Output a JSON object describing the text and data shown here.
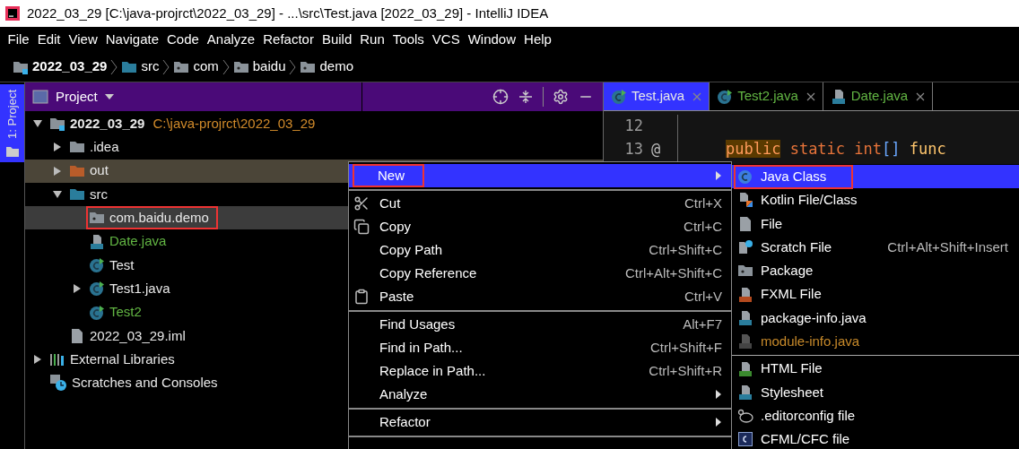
{
  "window": {
    "title": "2022_03_29 [C:\\java-projrct\\2022_03_29] - ...\\src\\Test.java [2022_03_29] - IntelliJ IDEA"
  },
  "menu_bar": [
    "File",
    "Edit",
    "View",
    "Navigate",
    "Code",
    "Analyze",
    "Refactor",
    "Build",
    "Run",
    "Tools",
    "VCS",
    "Window",
    "Help"
  ],
  "breadcrumb": [
    {
      "label": "2022_03_29",
      "kind": "project"
    },
    {
      "label": "src",
      "kind": "source"
    },
    {
      "label": "com",
      "kind": "package"
    },
    {
      "label": "baidu",
      "kind": "package"
    },
    {
      "label": "demo",
      "kind": "package"
    }
  ],
  "tool_stripe": {
    "label": "1: Project",
    "selected": true
  },
  "project_panel": {
    "title": "Project",
    "tree": [
      {
        "label": "2022_03_29",
        "kind": "project",
        "path": "C:\\java-projrct\\2022_03_29",
        "expanded": true,
        "selected": false,
        "hovered": false,
        "outlined": false,
        "added": false,
        "children": [
          {
            "label": ".idea",
            "kind": "folder",
            "expanded": false,
            "selected": false,
            "hovered": false,
            "outlined": false,
            "added": false
          },
          {
            "label": "out",
            "kind": "excluded",
            "expanded": false,
            "selected": false,
            "hovered": true,
            "outlined": false,
            "added": false
          },
          {
            "label": "src",
            "kind": "source",
            "expanded": true,
            "selected": false,
            "hovered": false,
            "outlined": false,
            "added": false,
            "children": [
              {
                "label": "com.baidu.demo",
                "kind": "package",
                "selected": true,
                "outlined": true,
                "added": false
              },
              {
                "label": "Date.java",
                "kind": "java",
                "selected": false,
                "hovered": false,
                "outlined": false,
                "added": true
              },
              {
                "label": "Test",
                "kind": "class",
                "selected": false,
                "hovered": false,
                "outlined": false,
                "added": false
              },
              {
                "label": "Test1.java",
                "kind": "class",
                "expanded": false,
                "selected": false,
                "hovered": false,
                "outlined": false,
                "added": false
              },
              {
                "label": "Test2",
                "kind": "class",
                "selected": false,
                "hovered": false,
                "outlined": false,
                "added": true
              }
            ]
          },
          {
            "label": "2022_03_29.iml",
            "kind": "iml",
            "selected": false,
            "hovered": false,
            "outlined": false,
            "added": false
          }
        ]
      },
      {
        "label": "External Libraries",
        "kind": "libraries",
        "expanded": false,
        "selected": false,
        "hovered": false,
        "outlined": false,
        "added": false
      },
      {
        "label": "Scratches and Consoles",
        "kind": "scratches",
        "selected": false,
        "hovered": false,
        "outlined": false,
        "added": false
      }
    ]
  },
  "editor": {
    "tabs": [
      {
        "label": "Test.java",
        "kind": "class",
        "selected": true,
        "added": false
      },
      {
        "label": "Test2.java",
        "kind": "class",
        "selected": false,
        "added": true
      },
      {
        "label": "Date.java",
        "kind": "java",
        "selected": false,
        "added": true
      }
    ],
    "lines": [
      {
        "number": "12"
      },
      {
        "number": "13",
        "gutter_mark": "@",
        "tokens": [
          {
            "text": "public",
            "kind": "keyword-highlighted"
          },
          {
            "text": " static int",
            "kind": "keyword"
          },
          {
            "text": "[]",
            "kind": "bracket"
          },
          {
            "text": " func",
            "kind": "function"
          }
        ]
      }
    ]
  },
  "context_menu": {
    "items": [
      {
        "kind": "submenu",
        "label": "New",
        "selected": true,
        "outlined": true
      },
      {
        "kind": "separator"
      },
      {
        "kind": "cut",
        "label": "Cut",
        "shortcut": "Ctrl+X",
        "selected": false,
        "outlined": false
      },
      {
        "kind": "copy",
        "label": "Copy",
        "shortcut": "Ctrl+C",
        "selected": false,
        "outlined": false
      },
      {
        "kind": "plain",
        "label": "Copy Path",
        "shortcut": "Ctrl+Shift+C",
        "selected": false,
        "outlined": false
      },
      {
        "kind": "plain",
        "label": "Copy Reference",
        "shortcut": "Ctrl+Alt+Shift+C",
        "selected": false,
        "outlined": false
      },
      {
        "kind": "paste",
        "label": "Paste",
        "shortcut": "Ctrl+V",
        "selected": false,
        "outlined": false
      },
      {
        "kind": "separator"
      },
      {
        "kind": "plain",
        "label": "Find Usages",
        "shortcut": "Alt+F7",
        "selected": false,
        "outlined": false
      },
      {
        "kind": "plain",
        "label": "Find in Path...",
        "shortcut": "Ctrl+Shift+F",
        "selected": false,
        "outlined": false
      },
      {
        "kind": "plain",
        "label": "Replace in Path...",
        "shortcut": "Ctrl+Shift+R",
        "selected": false,
        "outlined": false
      },
      {
        "kind": "submenu",
        "label": "Analyze",
        "selected": false,
        "outlined": false
      },
      {
        "kind": "separator"
      },
      {
        "kind": "submenu",
        "label": "Refactor",
        "selected": false,
        "outlined": false
      },
      {
        "kind": "separator"
      }
    ]
  },
  "submenu": {
    "items": [
      {
        "kind": "java-class",
        "label": "Java Class",
        "selected": true,
        "outlined": true,
        "disabled": false
      },
      {
        "kind": "kotlin",
        "label": "Kotlin File/Class",
        "selected": false,
        "outlined": false,
        "disabled": false
      },
      {
        "kind": "file",
        "label": "File",
        "selected": false,
        "outlined": false,
        "disabled": false
      },
      {
        "kind": "scratch",
        "label": "Scratch File",
        "shortcut": "Ctrl+Alt+Shift+Insert",
        "selected": false,
        "outlined": false,
        "disabled": false
      },
      {
        "kind": "package",
        "label": "Package",
        "selected": false,
        "outlined": false,
        "disabled": false
      },
      {
        "kind": "fxml",
        "label": "FXML File",
        "selected": false,
        "outlined": false,
        "disabled": false
      },
      {
        "kind": "java",
        "label": "package-info.java",
        "selected": false,
        "outlined": false,
        "disabled": false
      },
      {
        "kind": "java",
        "label": "module-info.java",
        "selected": false,
        "outlined": false,
        "disabled": true
      },
      {
        "kind": "separator"
      },
      {
        "kind": "html",
        "label": "HTML File",
        "selected": false,
        "outlined": false,
        "disabled": false
      },
      {
        "kind": "css",
        "label": "Stylesheet",
        "selected": false,
        "outlined": false,
        "disabled": false
      },
      {
        "kind": "editorconfig",
        "label": ".editorconfig file",
        "selected": false,
        "outlined": false,
        "disabled": false
      },
      {
        "kind": "cfml",
        "label": "CFML/CFC file",
        "selected": false,
        "outlined": false,
        "disabled": false
      }
    ]
  }
}
